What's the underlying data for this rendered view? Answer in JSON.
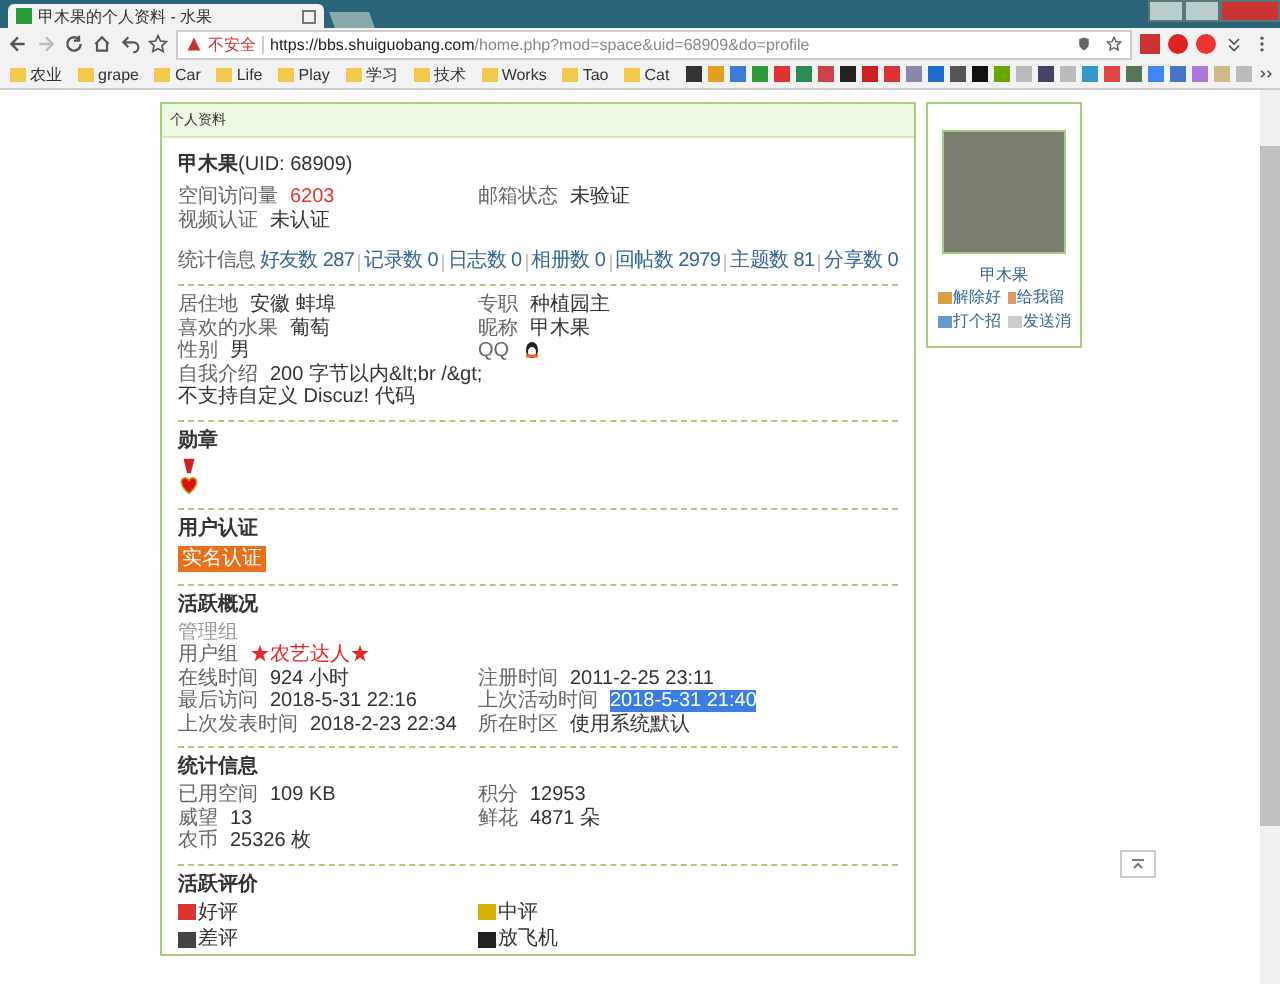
{
  "browser": {
    "tab_title": "甲木果的个人资料 - 水果",
    "security": "不安全",
    "url_host": "https://bbs.shuiguobang.com",
    "url_path": "/home.php?mod=space&uid=68909&do=profile",
    "bookmarks": [
      "农业",
      "grape",
      "Car",
      "Life",
      "Play",
      "学习",
      "技术",
      "Works",
      "Tao",
      "Cat"
    ]
  },
  "profile": {
    "header": "个人资料",
    "name": "甲木果",
    "uid": "(UID: 68909)",
    "sections": [
      {
        "kind": "fields",
        "fields": [
          {
            "kind": "highlight",
            "label": "空间访问量",
            "value": "6203"
          },
          {
            "kind": "text",
            "label": "邮箱状态",
            "value": "未验证"
          },
          {
            "kind": "text",
            "label": "视频认证",
            "value": "未认证"
          }
        ],
        "stats": {
          "label": "统计信息",
          "items": [
            {
              "label": "好友数",
              "value": "287"
            },
            {
              "label": "记录数",
              "value": "0"
            },
            {
              "label": "日志数",
              "value": "0"
            },
            {
              "label": "相册数",
              "value": "0"
            },
            {
              "label": "回帖数",
              "value": "2979"
            },
            {
              "label": "主题数",
              "value": "81"
            },
            {
              "label": "分享数",
              "value": "0"
            }
          ]
        }
      },
      {
        "kind": "fields",
        "fields": [
          {
            "kind": "text",
            "label": "居住地",
            "value": "安徽 蚌埠"
          },
          {
            "kind": "text",
            "label": "专职",
            "value": "种植园主"
          },
          {
            "kind": "text",
            "label": "喜欢的水果",
            "value": "葡萄"
          },
          {
            "kind": "text",
            "label": "昵称",
            "value": "甲木果"
          },
          {
            "kind": "text",
            "label": "性别",
            "value": "男"
          },
          {
            "kind": "qq",
            "label": "QQ"
          },
          {
            "kind": "wide",
            "label": "自我介绍",
            "value": "200 字节以内&lt;br /&gt;"
          },
          {
            "kind": "note",
            "value": "不支持自定义 Discuz! 代码"
          }
        ]
      },
      {
        "kind": "medal",
        "title": "勋章"
      },
      {
        "kind": "badge",
        "title": "用户认证",
        "badge": "实名认证"
      },
      {
        "kind": "fields",
        "title": "活跃概况",
        "fields": [
          {
            "kind": "muted",
            "label": "管理组"
          },
          {
            "kind": "group",
            "label": "用户组",
            "value": "★农艺达人★"
          },
          {
            "kind": "text",
            "label": "在线时间",
            "value": "924 小时"
          },
          {
            "kind": "text",
            "label": "注册时间",
            "value": "2011-2-25 23:11"
          },
          {
            "kind": "text",
            "label": "最后访问",
            "value": "2018-5-31 22:16"
          },
          {
            "kind": "selection",
            "label": "上次活动时间",
            "value": "2018-5-31 21:40"
          },
          {
            "kind": "text",
            "label": "上次发表时间",
            "value": "2018-2-23 22:34"
          },
          {
            "kind": "text",
            "label": "所在时区",
            "value": "使用系统默认"
          }
        ]
      },
      {
        "kind": "fields",
        "title": "统计信息",
        "fields": [
          {
            "kind": "text",
            "label": "已用空间",
            "value": "109 KB"
          },
          {
            "kind": "text",
            "label": "积分",
            "value": "12953"
          },
          {
            "kind": "text",
            "label": "威望",
            "value": "13"
          },
          {
            "kind": "text",
            "label": "鲜花",
            "value": "4871 朵"
          },
          {
            "kind": "wide",
            "label": "农币",
            "value": "25326 枚"
          }
        ]
      },
      {
        "kind": "ratings",
        "title": "活跃评价",
        "ratings": [
          {
            "kind": "good",
            "label": "好评"
          },
          {
            "kind": "neutral",
            "label": "中评"
          },
          {
            "kind": "bad",
            "label": "差评"
          },
          {
            "kind": "plane",
            "label": "放飞机"
          }
        ]
      }
    ]
  },
  "sidebar": {
    "name": "甲木果",
    "actions": [
      {
        "kind": "handshake",
        "label": "解除好"
      },
      {
        "kind": "pencil",
        "label": "给我留"
      },
      {
        "kind": "wave",
        "label": "打个招"
      },
      {
        "kind": "mail",
        "label": "发送消"
      }
    ]
  }
}
